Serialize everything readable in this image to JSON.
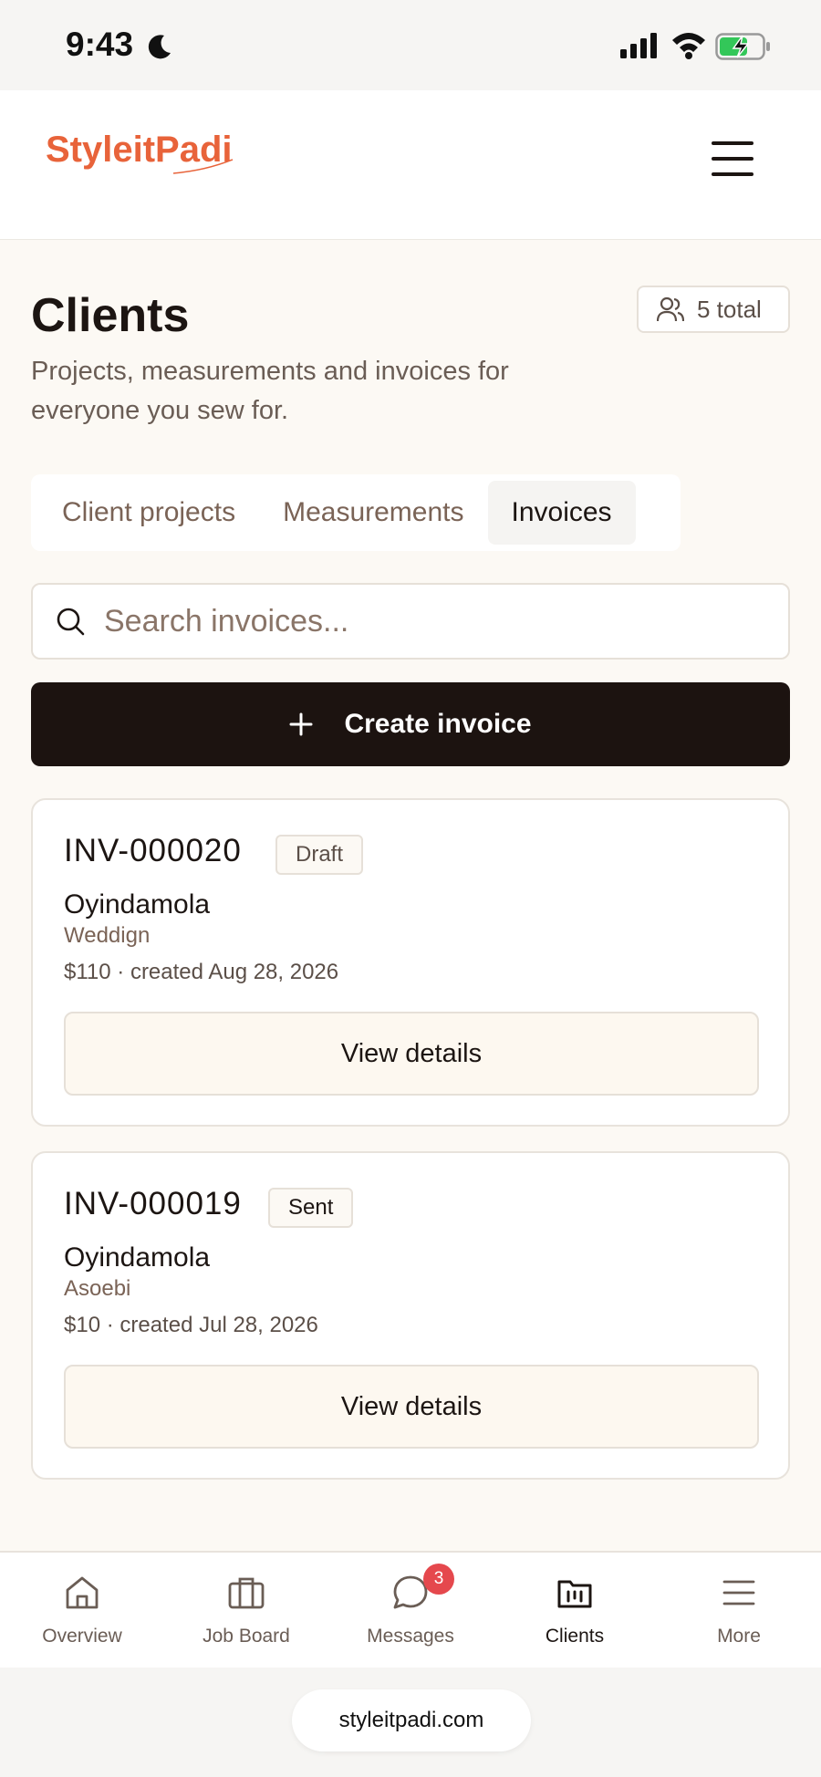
{
  "status_bar": {
    "time": "9:43"
  },
  "header": {
    "brand": "StyleitPadi",
    "brand_color": "#e8633a"
  },
  "page": {
    "title": "Clients",
    "subtitle": "Projects, measurements and invoices for everyone you sew for.",
    "total_badge": "5 total"
  },
  "tabs": [
    {
      "label": "Client projects",
      "active": false
    },
    {
      "label": "Measurements",
      "active": false
    },
    {
      "label": "Invoices",
      "active": true
    }
  ],
  "search": {
    "placeholder": "Search invoices...",
    "value": ""
  },
  "actions": {
    "create_label": "Create invoice"
  },
  "invoices": [
    {
      "number": "INV-000020",
      "status": "Draft",
      "client": "Oyindamola",
      "project": "Weddign",
      "meta": "$110 · created Aug 28, 2026",
      "button": "View details"
    },
    {
      "number": "INV-000019",
      "status": "Sent",
      "client": "Oyindamola",
      "project": "Asoebi",
      "meta": "$10 · created Jul 28, 2026",
      "button": "View details"
    }
  ],
  "bottom_nav": [
    {
      "label": "Overview",
      "icon": "home-icon",
      "active": false
    },
    {
      "label": "Job Board",
      "icon": "briefcase-icon",
      "active": false
    },
    {
      "label": "Messages",
      "icon": "chat-icon",
      "active": false,
      "badge": "3"
    },
    {
      "label": "Clients",
      "icon": "folder-icon",
      "active": true
    },
    {
      "label": "More",
      "icon": "menu-icon",
      "active": false
    }
  ],
  "browser": {
    "url": "styleitpadi.com"
  },
  "colors": {
    "primary_dark": "#1c1310",
    "background": "#fcf9f4",
    "badge_red": "#e5484d"
  }
}
